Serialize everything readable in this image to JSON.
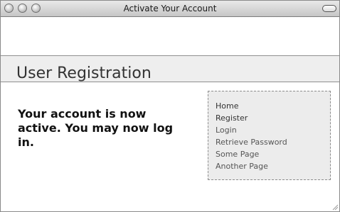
{
  "window": {
    "title": "Activate Your Account"
  },
  "page": {
    "heading": "User Registration",
    "message": "Your account is now active. You may now log in."
  },
  "nav": {
    "items": [
      {
        "label": "Home"
      },
      {
        "label": "Register"
      },
      {
        "label": "Login"
      },
      {
        "label": "Retrieve Password"
      },
      {
        "label": "Some Page"
      },
      {
        "label": "Another Page"
      }
    ]
  }
}
